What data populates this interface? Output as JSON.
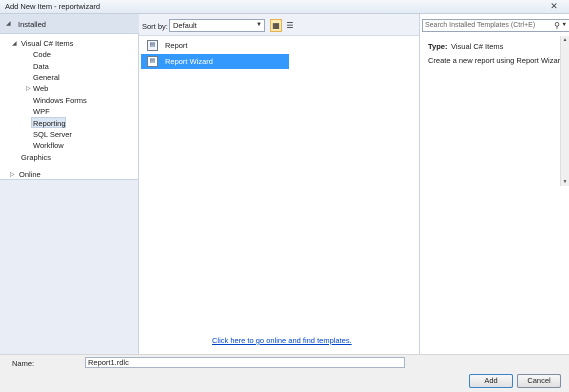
{
  "window": {
    "title": "Add New Item - reportwizard",
    "close_glyph": "✕"
  },
  "left": {
    "installed": "Installed",
    "tree": {
      "root": "Visual C# Items",
      "children": [
        "Code",
        "Data",
        "General",
        "Web",
        "Windows Forms",
        "WPF",
        "Reporting",
        "SQL Server",
        "Workflow"
      ],
      "graphics": "Graphics"
    },
    "online": "Online",
    "selected": "Reporting"
  },
  "toolbar": {
    "sort_label": "Sort by:",
    "sort_value": "Default",
    "view_icons": [
      "grid-view-icon",
      "list-view-icon"
    ]
  },
  "templates": [
    {
      "name": "Report",
      "icon": "report-icon"
    },
    {
      "name": "Report Wizard",
      "icon": "report-wizard-icon",
      "selected": true
    }
  ],
  "online_link": "Click here to go online and find templates.",
  "search": {
    "placeholder": "Search Installed Templates (Ctrl+E)"
  },
  "details": {
    "type_label": "Type:",
    "type_value": "Visual C# Items",
    "description": "Create a new report using Report Wizard"
  },
  "bottom": {
    "name_label": "Name:",
    "name_value": "Report1.rdlc",
    "add_label": "Add",
    "cancel_label": "Cancel"
  },
  "colors": {
    "selection": "#3399ff",
    "link": "#0044cc"
  }
}
